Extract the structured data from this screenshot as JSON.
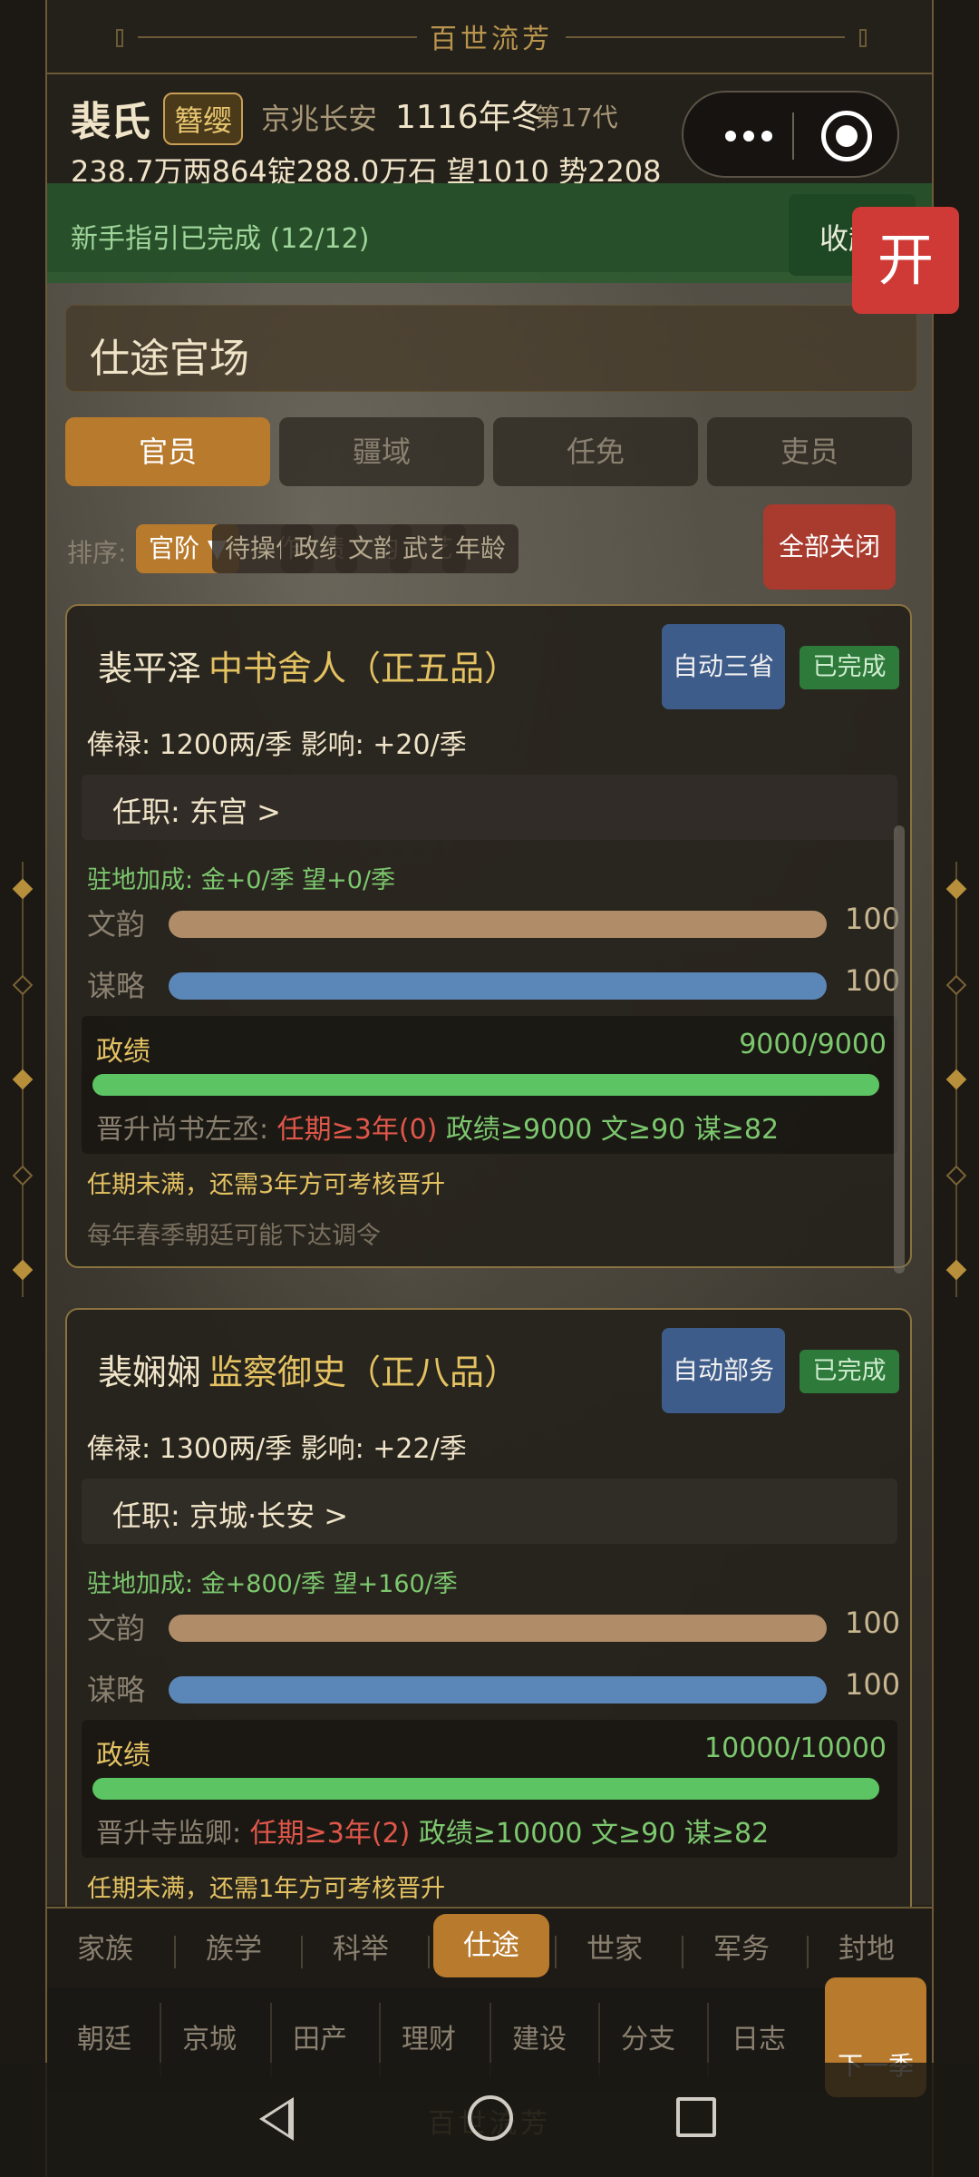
{
  "app": {
    "title": "百世流芳"
  },
  "header": {
    "clan": "裴氏",
    "rank_badge": "簪缨",
    "location": "京兆长安",
    "date": "1116年冬",
    "generation": "第17代",
    "stats": "238.7万两864锭288.0万石  望1010 势2208"
  },
  "guide": {
    "text": "新手指引已完成 (12/12)",
    "collapse": "收起",
    "open": "开"
  },
  "section": {
    "title": "仕途官场"
  },
  "tabs": [
    "官员",
    "疆域",
    "任免",
    "吏员"
  ],
  "sort": {
    "label": "排序:",
    "chips": [
      "官阶 ▼",
      "待操作",
      "政绩",
      "文韵",
      "武艺",
      "年龄"
    ],
    "close_all": "全部关闭"
  },
  "officials": [
    {
      "name": "裴平泽",
      "post": "中书舍人（正五品）",
      "auto": "自动三省",
      "status": "已完成",
      "salary": "俸禄: 1200两/季   影响: +20/季",
      "station": "任职: 东宫  >",
      "bonus": "驻地加成: 金+0/季  望+0/季",
      "wen_label": "文韵",
      "wen": 100,
      "mou_label": "谋略",
      "mou": 100,
      "perf_label": "政绩",
      "perf_text": "9000/9000",
      "perf_ratio": 1.0,
      "promo_target": "晋升尚书左丞: ",
      "promo_term": "任期≥3年(0)",
      "promo_rest": "  政绩≥9000  文≥90  谋≥82",
      "warn": "任期未满，还需3年方可考核晋升",
      "note": "每年春季朝廷可能下达调令"
    },
    {
      "name": "裴娴娴",
      "post": "监察御史（正八品）",
      "auto": "自动部务",
      "status": "已完成",
      "salary": "俸禄: 1300两/季   影响: +22/季",
      "station": "任职: 京城·长安  >",
      "bonus": "驻地加成: 金+800/季  望+160/季",
      "wen_label": "文韵",
      "wen": 100,
      "mou_label": "谋略",
      "mou": 100,
      "perf_label": "政绩",
      "perf_text": "10000/10000",
      "perf_ratio": 1.0,
      "promo_target": "晋升寺监卿: ",
      "promo_term": "任期≥3年(2)",
      "promo_rest": "  政绩≥10000  文≥90  谋≥82",
      "warn": "任期未满，还需1年方可考核晋升"
    }
  ],
  "bottom_nav": [
    "家族",
    "族学",
    "科举",
    "仕途",
    "世家",
    "军务",
    "封地"
  ],
  "sub_nav": [
    "朝廷",
    "京城",
    "田产",
    "理财",
    "建设",
    "分支",
    "日志"
  ],
  "next_season": "下一季",
  "colors": {
    "accent": "#b87a2c",
    "gold": "#e4c262",
    "green": "#5cc462",
    "wen_bar": "#b08d68",
    "mou_bar": "#5b87b8",
    "red": "#d03a36"
  }
}
